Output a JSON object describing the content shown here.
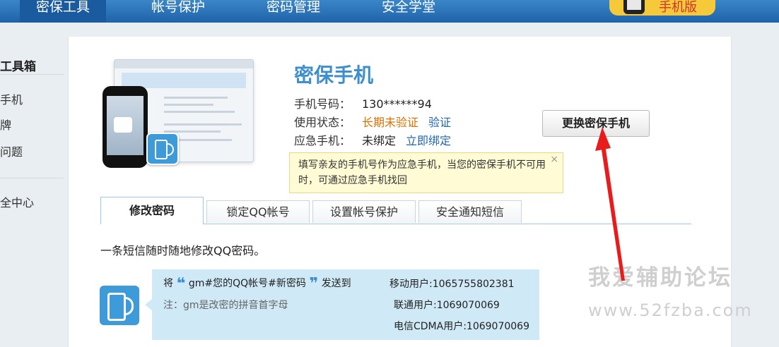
{
  "nav": {
    "items": [
      "密保工具",
      "帐号保护",
      "密码管理",
      "安全学堂"
    ],
    "promo_text": "手机版"
  },
  "sidebar": {
    "title": "工具箱",
    "items": [
      "手机",
      "牌",
      "问题",
      "全中心"
    ]
  },
  "card": {
    "title": "密保手机",
    "phone_label": "手机号码：",
    "phone_value": "130******94",
    "status_label": "使用状态：",
    "status_value": "长期未验证",
    "verify_link": "验证",
    "emergency_label": "应急手机：",
    "emergency_value": "未绑定",
    "bind_link": "立即绑定",
    "change_button": "更换密保手机",
    "tip_text": "填写亲友的手机号作为应急手机，当您的密保手机不可用时，可通过应急手机找回",
    "tip_close": "×"
  },
  "tabs": [
    "修改密码",
    "锁定QQ帐号",
    "设置帐号保护",
    "安全通知短信"
  ],
  "content": {
    "description": "一条短信随时随地修改QQ密码。",
    "sms_prefix": "将",
    "sms_open_quote": "❝",
    "sms_command": "gm#您的QQ帐号#新密码",
    "sms_close_quote": "❞",
    "sms_suffix": "发送到",
    "sms_note": "注：gm是改密的拼音首字母",
    "carriers": [
      "移动用户:1065755802381",
      "联通用户:1069070069",
      "电信CDMA用户:1069070069"
    ]
  },
  "watermark": {
    "line1": "我爱辅助论坛",
    "line2": "www.52fzba.com"
  },
  "colors": {
    "nav_bg": "#2a74bb",
    "title_blue": "#3e8fcf",
    "warning_orange": "#e07000",
    "link_blue": "#2066b0",
    "tip_bg": "#fffbd5",
    "sms_bg": "#cfe9f6",
    "annotation_red": "#e81c1c"
  }
}
